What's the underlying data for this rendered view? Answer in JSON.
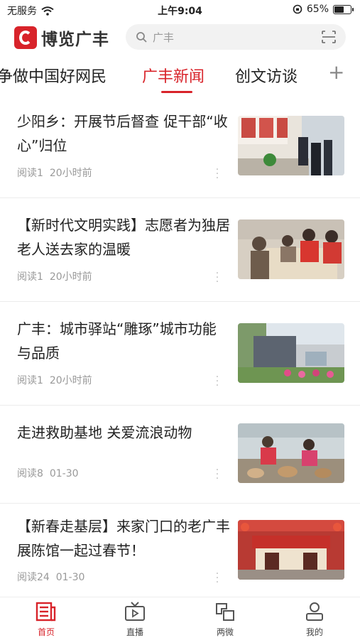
{
  "status": {
    "carrier": "无服务",
    "time": "上午9:04",
    "battery": "65%",
    "battery_level": 0.65
  },
  "header": {
    "app_name": "博览广丰",
    "search_placeholder": "广丰"
  },
  "tabs": [
    {
      "label": "争做中国好网民",
      "active": false
    },
    {
      "label": "广丰新闻",
      "active": true
    },
    {
      "label": "创文访谈",
      "active": false
    }
  ],
  "articles": [
    {
      "title": "少阳乡：开展节后督查 促干部“收心”归位",
      "reads": "阅读1",
      "time": "20小时前"
    },
    {
      "title": "【新时代文明实践】志愿者为独居老人送去家的温暖",
      "reads": "阅读1",
      "time": "20小时前"
    },
    {
      "title": "广丰：城市驿站“雕琢”城市功能与品质",
      "reads": "阅读1",
      "time": "20小时前"
    },
    {
      "title": "走进救助基地 关爱流浪动物",
      "reads": "阅读8",
      "time": "01-30"
    },
    {
      "title": "【新春走基层】来家门口的老广丰展陈馆一起过春节！",
      "reads": "阅读24",
      "time": "01-30"
    }
  ],
  "bottom_nav": [
    {
      "label": "首页",
      "icon": "home-news-icon",
      "active": true
    },
    {
      "label": "直播",
      "icon": "tv-play-icon",
      "active": false
    },
    {
      "label": "两微",
      "icon": "weibo-wechat-icon",
      "active": false
    },
    {
      "label": "我的",
      "icon": "user-icon",
      "active": false
    }
  ],
  "colors": {
    "accent": "#d8232a"
  }
}
